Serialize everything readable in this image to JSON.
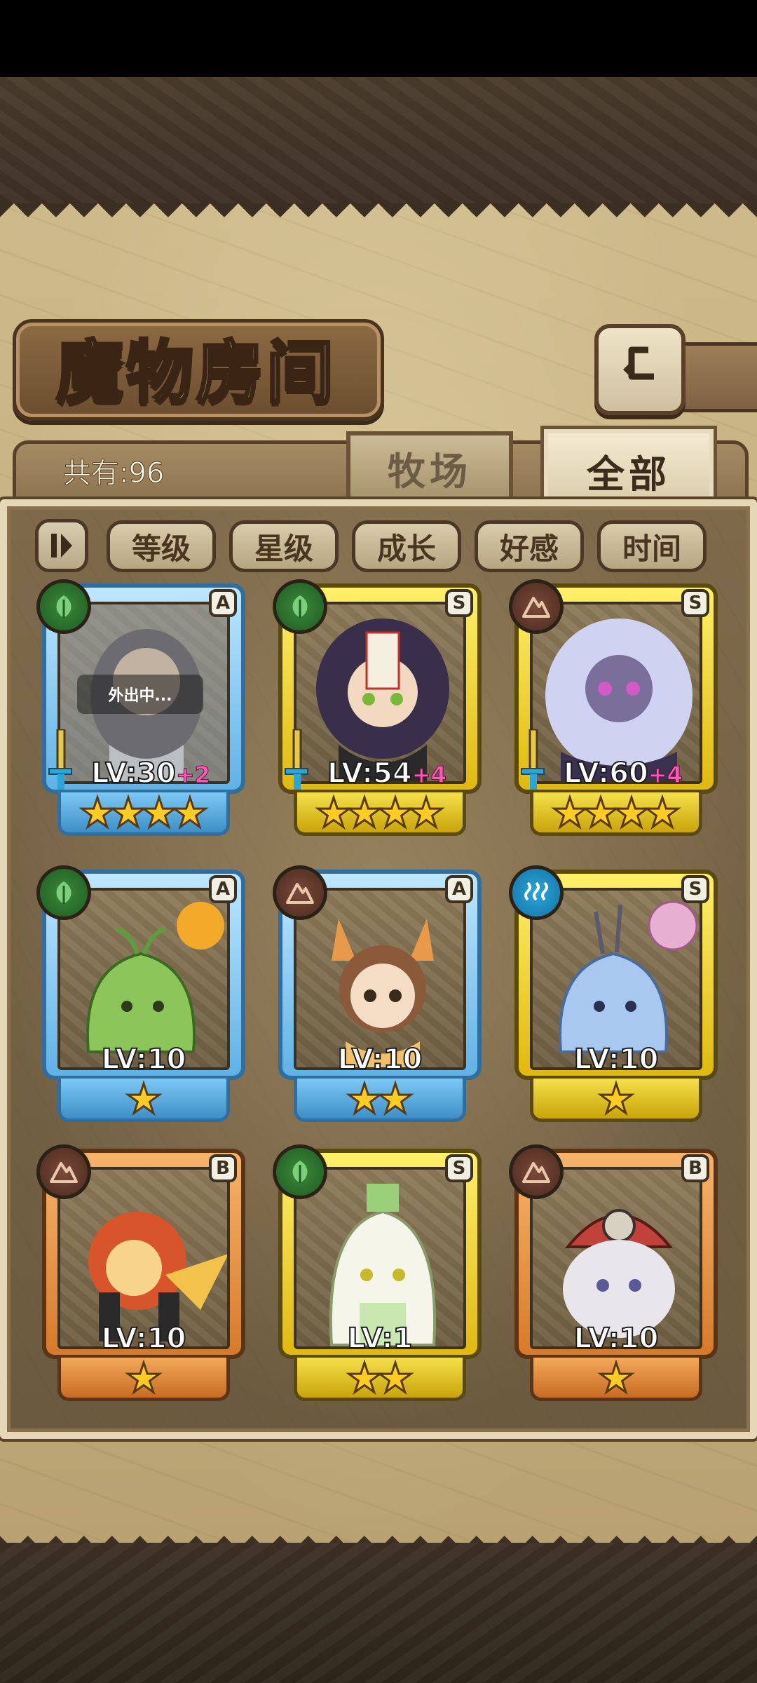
{
  "title": "魔物房间",
  "count_label": "共有:96",
  "tabs": [
    {
      "label": "牧场",
      "active": false
    },
    {
      "label": "全部",
      "active": true
    }
  ],
  "filters": [
    "等级",
    "星级",
    "成长",
    "好感",
    "时间"
  ],
  "monsters": [
    {
      "grade": "A",
      "element": "leaf",
      "frame": "blue",
      "level": "LV:30",
      "bonus": "+2",
      "stars": 4,
      "weapon": true,
      "status": "外出中..."
    },
    {
      "grade": "S",
      "element": "leaf",
      "frame": "gold",
      "level": "LV:54",
      "bonus": "+4",
      "stars": 4,
      "weapon": true,
      "status": ""
    },
    {
      "grade": "S",
      "element": "earth",
      "frame": "gold",
      "level": "LV:60",
      "bonus": "+4",
      "stars": 4,
      "weapon": true,
      "status": ""
    },
    {
      "grade": "A",
      "element": "leaf",
      "frame": "blue",
      "level": "LV:10",
      "bonus": "",
      "stars": 1,
      "weapon": false,
      "status": ""
    },
    {
      "grade": "A",
      "element": "earth",
      "frame": "blue",
      "level": "LV:10",
      "bonus": "",
      "stars": 2,
      "weapon": false,
      "status": ""
    },
    {
      "grade": "S",
      "element": "water",
      "frame": "gold",
      "level": "LV:10",
      "bonus": "",
      "stars": 1,
      "weapon": false,
      "status": ""
    },
    {
      "grade": "B",
      "element": "earth",
      "frame": "orange",
      "level": "LV:10",
      "bonus": "",
      "stars": 1,
      "weapon": false,
      "status": ""
    },
    {
      "grade": "S",
      "element": "leaf",
      "frame": "gold",
      "level": "LV:1",
      "bonus": "",
      "stars": 2,
      "weapon": false,
      "status": ""
    },
    {
      "grade": "B",
      "element": "earth",
      "frame": "orange",
      "level": "LV:10",
      "bonus": "",
      "stars": 1,
      "weapon": false,
      "status": ""
    }
  ],
  "colors": {
    "leaf": "#2e7a2e",
    "earth": "#6a3a2a",
    "water": "#1f8cc4",
    "bonus": "#ff59b5",
    "star": "#ffcc22"
  },
  "icons": {
    "back": "return-arrow-icon",
    "sort": "sort-toggle-icon",
    "leaf": "leaf-icon",
    "earth": "mountain-icon",
    "water": "wave-icon",
    "weapon": "sword-icon"
  }
}
